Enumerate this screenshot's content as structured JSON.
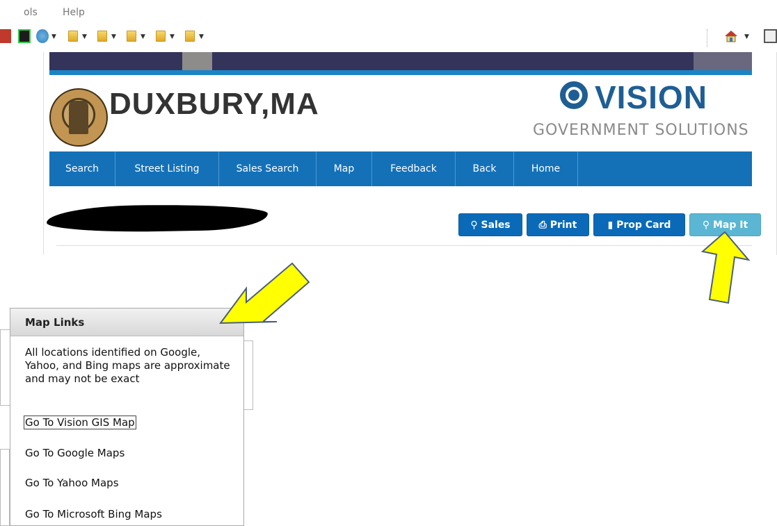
{
  "browser": {
    "menu": [
      "ols",
      "Help"
    ]
  },
  "site": {
    "town": "DUXBURY,MA",
    "vendor_name": "VISION",
    "vendor_tagline": "GOVERNMENT SOLUTIONS",
    "nav": [
      "Search",
      "Street Listing",
      "Sales Search",
      "Map",
      "Feedback",
      "Back",
      "Home"
    ]
  },
  "actions": {
    "sales": "Sales",
    "print": "Print",
    "prop_card": "Prop Card",
    "map_it": "Map It"
  },
  "popover": {
    "title": "Map Links",
    "disclaimer": "All locations identified on Google, Yahoo, and Bing maps are approximate and may not be exact",
    "links": [
      "Go To Vision GIS Map",
      "Go To Google Maps",
      "Go To Yahoo Maps",
      "Go To Microsoft Bing Maps"
    ]
  },
  "colors": {
    "nav_blue": "#1471b8",
    "button_blue": "#0b6ab8",
    "button_teal": "#5bb6d3",
    "arrow_yellow": "#ffff00"
  }
}
